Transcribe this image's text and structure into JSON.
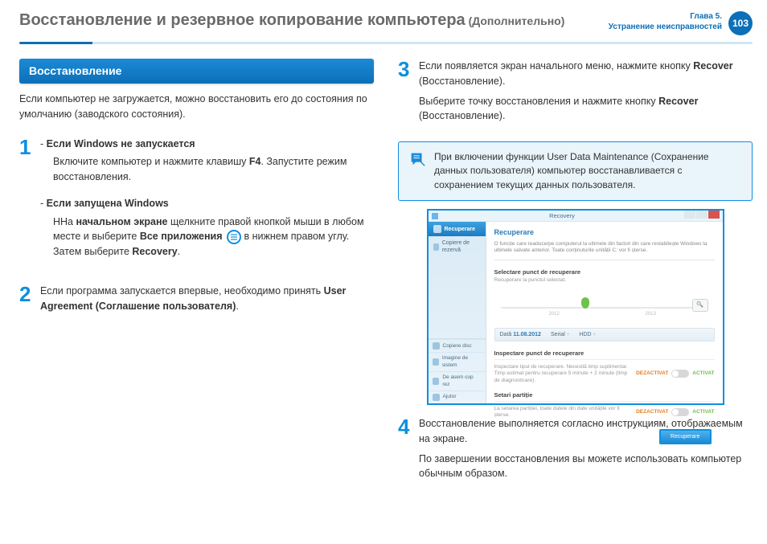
{
  "header": {
    "title_main": "Восстановление и резервное копирование компьютера",
    "title_sub": " (Дополнительно)",
    "chapter_line1": "Глава 5.",
    "chapter_line2": "Устранение неисправностей",
    "page_number": "103"
  },
  "left": {
    "section_title": "Восстановление",
    "intro": "Если компьютер не загружается, можно восстановить его до состояния по умолчанию (заводского состояния).",
    "step1": {
      "num": "1",
      "case_a_title": "Если Windows не запускается",
      "case_a_line1_pre": "Включите компьютер и нажмите клавишу ",
      "case_a_line1_bold": "F4",
      "case_a_line1_post": ". Запустите режим восстановления.",
      "case_b_title": "Если запущена Windows",
      "case_b_line1_pre": "ННа ",
      "case_b_line1_bold": "начальном экране",
      "case_b_line1_mid": " щелкните правой кнопкой мыши в любом месте и выберите ",
      "case_b_line1_bold2": "Все приложения",
      "case_b_line2": " в нижнем правом углу. Затем выберите ",
      "case_b_line2_bold": "Recovery",
      "case_b_line2_post": "."
    },
    "step2": {
      "num": "2",
      "p1_pre": "Если программа запускается впервые, необходимо принять ",
      "p1_bold": "User Agreement (Соглашение пользователя)",
      "p1_post": "."
    }
  },
  "right": {
    "step3": {
      "num": "3",
      "p1_pre": "Если появляется экран начального меню, нажмите кнопку ",
      "p1_bold": "Recover",
      "p1_post": " (Восстановление).",
      "p2_pre": "Выберите точку восстановления и нажмите кнопку ",
      "p2_bold": "Recover",
      "p2_post": " (Восстановление)."
    },
    "note": "При включении функции User Data Maintenance (Сохранение данных пользователя) компьютер восстанавливается с сохранением текущих данных пользователя.",
    "step4": {
      "num": "4",
      "p1": "Восстановление выполняется согласно инструкциям, отображаемым на экране.",
      "p2": "По завершении восстановления вы можете использовать компьютер обычным образом."
    }
  },
  "app": {
    "title": "Recovery",
    "side_top": "Recuperare",
    "side_item1": "Copiere de rezervă",
    "side_b1": "Copiere disc",
    "side_b2": "Imagine de sistem",
    "side_b3": "De asem cop rez",
    "side_b4": "Ajutor",
    "h1": "Recuperare",
    "desc": "O funcție care readuce/pe computerul la ultimele din factori din care restabilește Windows la ultimele salvate anterior. Toate conținuturile unității C: vor fi șterse.",
    "sub1": "Selectare punct de recuperare",
    "subdesc1": "Recuperare la punctul selectat.",
    "year_a": "2012",
    "year_b": "2013",
    "bar_date_label": "Dată",
    "bar_date_val": "11.08.2012",
    "bar_serial_label": "Serial",
    "bar_hdd_label": "HDD",
    "sub2": "Inspectare punct de recuperare",
    "row1_txt": "Inspectare tipul de recuperare. Necesită timp suplimentar. Timp estimat pentru recuperare 5 minute + 2 minute (timp de diagnosticare).",
    "sub3": "Setari partiție",
    "row2_txt": "La setarea partiției, toate datele din date unitățile vor fi șterse.",
    "toggle_off": "DEZACTIVAT",
    "toggle_on": "ACTIVAT",
    "button": "Recuperare",
    "magnify_icon": "🔍"
  }
}
